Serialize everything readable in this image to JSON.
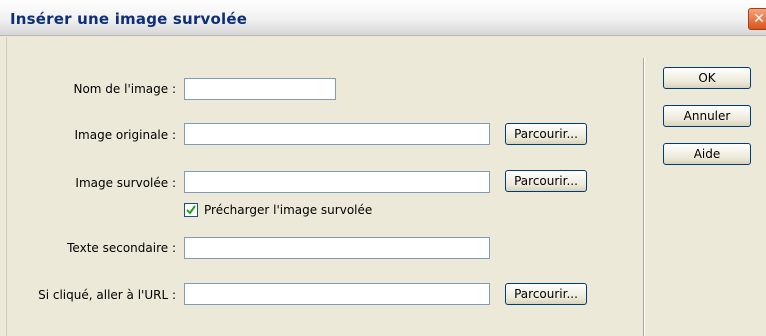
{
  "window": {
    "title": "Insérer une image survolée",
    "close_glyph": "✕"
  },
  "form": {
    "image_name": {
      "label": "Nom de l'image :",
      "value": ""
    },
    "original_image": {
      "label": "Image originale :",
      "value": "",
      "browse_label": "Parcourir..."
    },
    "rollover_image": {
      "label": "Image survolée :",
      "value": "",
      "browse_label": "Parcourir..."
    },
    "preload": {
      "label": "Précharger l'image survolée",
      "checked": true
    },
    "alt_text": {
      "label": "Texte secondaire :",
      "value": ""
    },
    "url": {
      "label": "Si cliqué, aller à l'URL :",
      "value": "",
      "browse_label": "Parcourir..."
    }
  },
  "actions": {
    "ok_label": "OK",
    "cancel_label": "Annuler",
    "help_label": "Aide"
  },
  "colors": {
    "title_text": "#0d2f7a",
    "dialog_bg": "#ece9d8",
    "field_border": "#7f9db9",
    "button_border": "#003c74",
    "close_button": "#d8541c"
  }
}
